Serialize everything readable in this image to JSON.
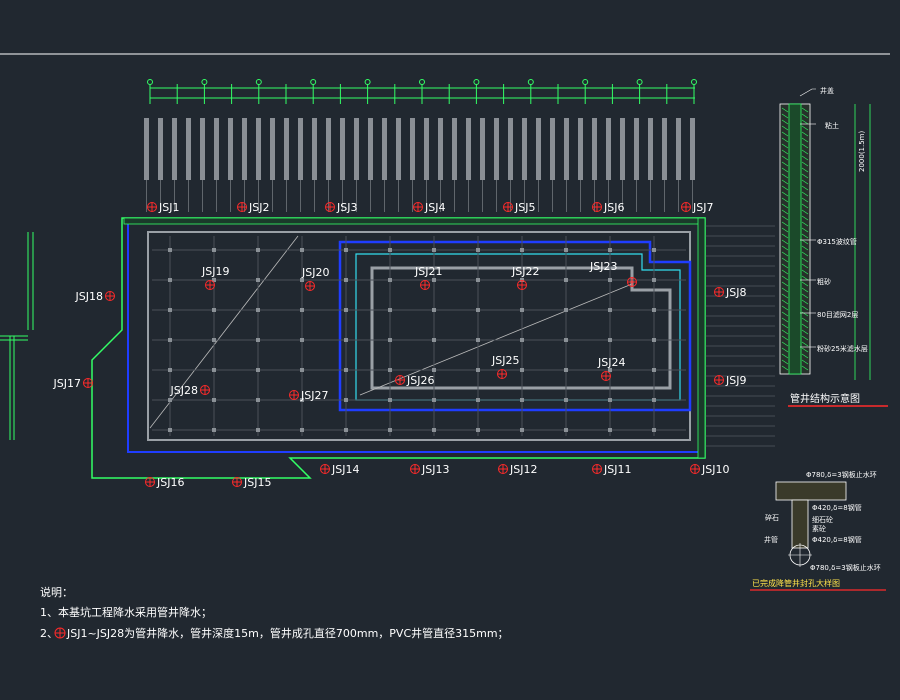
{
  "drawing": {
    "wells": [
      "JSJ1",
      "JSJ2",
      "JSJ3",
      "JSJ4",
      "JSJ5",
      "JSJ6",
      "JSJ7",
      "JSJ8",
      "JSJ9",
      "JSJ10",
      "JSJ11",
      "JSJ12",
      "JSJ13",
      "JSJ14",
      "JSJ15",
      "JSJ16",
      "JSJ17",
      "JSJ18",
      "JSJ19",
      "JSJ20",
      "JSJ21",
      "JSJ22",
      "JSJ23",
      "JSJ24",
      "JSJ25",
      "JSJ26",
      "JSJ27",
      "JSJ28"
    ],
    "notes": {
      "heading": "说明：",
      "line1": "1、本基坑工程降水采用管井降水；",
      "line2_prefix": "2、",
      "line2_text": "JSJ1~JSJ28为管井降水，管井深度15m，管井成孔直径700mm，PVC井管直径315mm；"
    },
    "well_structure": {
      "title": "管井结构示意图",
      "labels": [
        "井盖",
        "粘土",
        "Φ315波纹管",
        "粗砂",
        "80目滤网2层",
        "粉砂25米滤水层"
      ],
      "dim_top": "2000(1.5m)"
    },
    "seal_detail": {
      "title": "已完成降管井封孔大样图",
      "labels": [
        "Φ780,δ=3钢板止水环",
        "Φ420,δ=8钢管",
        "碎石",
        "细石砼",
        "素砼",
        "Φ420,δ=8钢管",
        "井管",
        "Φ780,δ=3钢板止水环"
      ]
    },
    "colors": {
      "background": "#212830",
      "outline_green": "#33ff66",
      "outline_blue": "#1f3dff",
      "outline_cyan": "#33ddee",
      "structure_grey": "#9aa0a6",
      "well_red": "#ff2a2a",
      "text": "#ffffff",
      "accent_yellow": "#ffe34a"
    }
  }
}
